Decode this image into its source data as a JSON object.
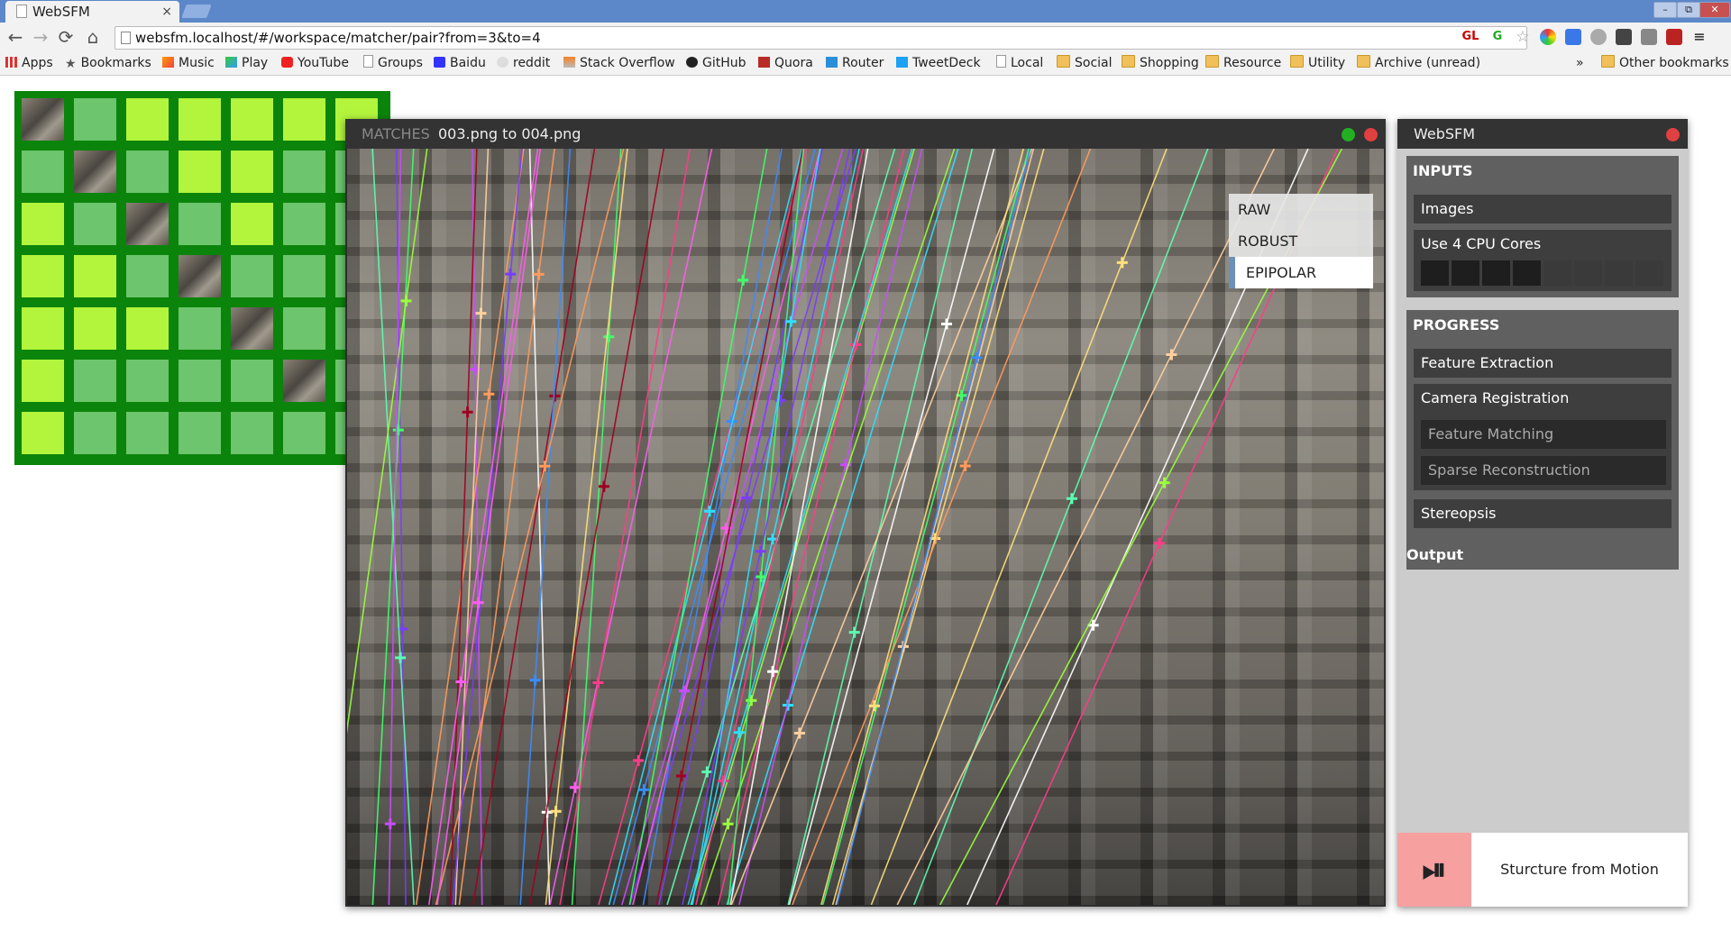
{
  "browser": {
    "tab_title": "WebSFM",
    "tab_close": "×",
    "url": "websfm.localhost/#/workspace/matcher/pair?from=3&to=4",
    "nav": {
      "back": "←",
      "forward": "→",
      "reload": "⟳",
      "home": "⌂"
    },
    "window_buttons": {
      "minimize": "–",
      "restore": "⧉",
      "close": "✕"
    },
    "extensions": [
      "GL",
      "G",
      "☆"
    ],
    "bookmarks": [
      {
        "label": "Apps",
        "icon": "apps-icon"
      },
      {
        "label": "Bookmarks",
        "icon": "star-icon"
      },
      {
        "label": "Music",
        "icon": "play-store-icon"
      },
      {
        "label": "Play",
        "icon": "play-store-icon"
      },
      {
        "label": "YouTube",
        "icon": "youtube-icon"
      },
      {
        "label": "Groups",
        "icon": "page-icon"
      },
      {
        "label": "Baidu",
        "icon": "baidu-icon"
      },
      {
        "label": "reddit",
        "icon": "reddit-icon"
      },
      {
        "label": "Stack Overflow",
        "icon": "stackoverflow-icon"
      },
      {
        "label": "GitHub",
        "icon": "github-icon"
      },
      {
        "label": "Quora",
        "icon": "quora-icon"
      },
      {
        "label": "Router",
        "icon": "router-icon"
      },
      {
        "label": "TweetDeck",
        "icon": "tweetdeck-icon"
      },
      {
        "label": "Local",
        "icon": "page-icon"
      },
      {
        "label": "Social",
        "icon": "folder-icon"
      },
      {
        "label": "Shopping",
        "icon": "folder-icon"
      },
      {
        "label": "Resource",
        "icon": "folder-icon"
      },
      {
        "label": "Utility",
        "icon": "folder-icon"
      },
      {
        "label": "Archive (unread)",
        "icon": "folder-icon"
      }
    ],
    "overflow": "»",
    "other_bookmarks": "Other bookmarks"
  },
  "matrix": {
    "colors": {
      "background": "#0b840b",
      "matched": "#b2f53c",
      "partial": "#6dc56d"
    },
    "rows": [
      [
        "photo",
        "partial",
        "matched",
        "matched",
        "matched",
        "matched",
        "matched"
      ],
      [
        "partial",
        "photo",
        "partial",
        "matched",
        "matched",
        "partial",
        "partial"
      ],
      [
        "matched",
        "partial",
        "photo",
        "partial",
        "matched",
        "partial",
        "partial"
      ],
      [
        "matched",
        "matched",
        "partial",
        "photo",
        "partial",
        "partial",
        "partial"
      ],
      [
        "matched",
        "matched",
        "matched",
        "partial",
        "photo",
        "partial",
        "partial"
      ],
      [
        "matched",
        "partial",
        "partial",
        "partial",
        "partial",
        "photo",
        "partial"
      ],
      [
        "matched",
        "partial",
        "partial",
        "partial",
        "partial",
        "partial",
        "partial"
      ]
    ]
  },
  "matches_window": {
    "label": "MATCHES",
    "files": "003.png to 004.png",
    "status_dot_color": "#22b022",
    "close_dot_color": "#e04040",
    "modes": [
      "RAW",
      "ROBUST",
      "EPIPOLAR"
    ],
    "selected_mode": "EPIPOLAR"
  },
  "panel": {
    "title": "WebSFM",
    "inputs": {
      "heading": "INPUTS",
      "images": "Images",
      "cpu_label": "Use 4 CPU Cores",
      "cores_total": 8,
      "cores_selected": 4
    },
    "progress": {
      "heading": "PROGRESS",
      "feature_extraction": "Feature Extraction",
      "camera_registration": "Camera Registration",
      "feature_matching": "Feature Matching",
      "sparse_reconstruction": "Sparse Reconstruction",
      "stereopsis": "Stereopsis"
    },
    "output": {
      "heading": "Output"
    },
    "play_pause": "⏯",
    "footer_title": "Sturcture from Motion"
  }
}
